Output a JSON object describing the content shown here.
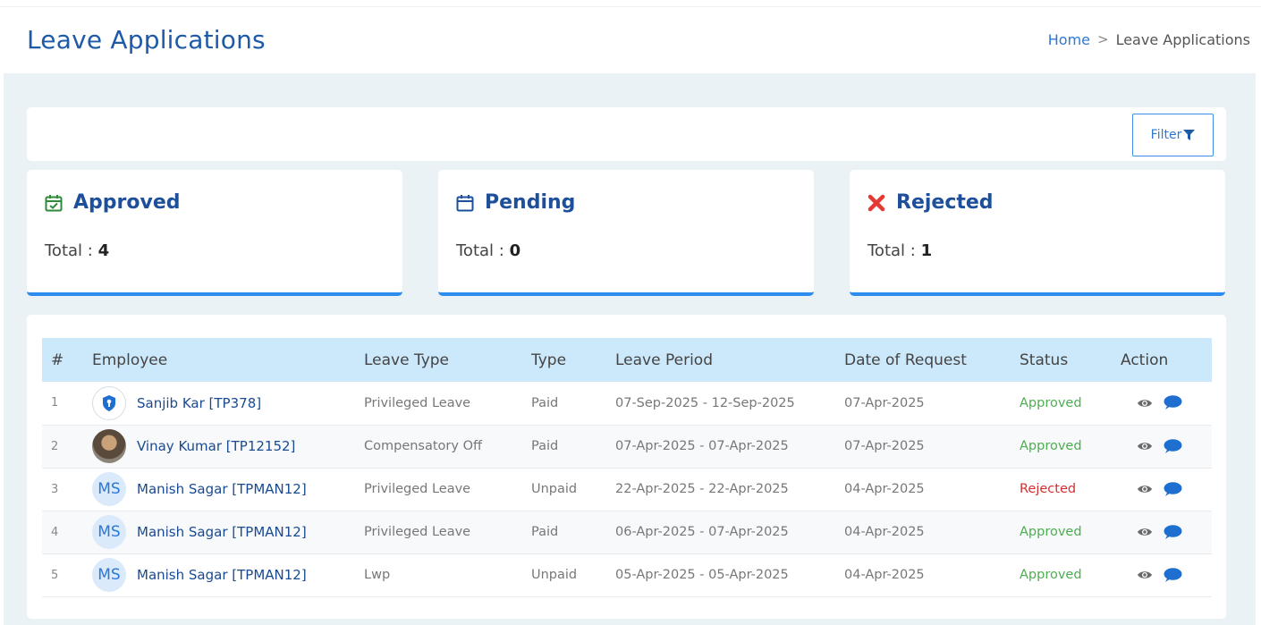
{
  "header": {
    "title": "Leave Applications",
    "breadcrumb": {
      "home": "Home",
      "separator": ">",
      "current": "Leave Applications"
    }
  },
  "filter": {
    "label": "Filter",
    "icon": "funnel-icon"
  },
  "summary": [
    {
      "title": "Approved",
      "icon": "calendar-check-icon",
      "total_label": "Total :",
      "total": "4",
      "color": "#2e8b3a"
    },
    {
      "title": "Pending",
      "icon": "calendar-icon",
      "total_label": "Total :",
      "total": "0",
      "color": "#1e4f9a"
    },
    {
      "title": "Rejected",
      "icon": "x-mark-icon",
      "total_label": "Total :",
      "total": "1",
      "color": "#e53935"
    }
  ],
  "table": {
    "columns": [
      "#",
      "Employee",
      "Leave Type",
      "Type",
      "Leave Period",
      "Date of Request",
      "Status",
      "Action"
    ],
    "rows": [
      {
        "idx": "1",
        "avatar": "logo",
        "avatar_text": "",
        "employee": "Sanjib Kar [TP378]",
        "leave_type": "Privileged Leave",
        "type": "Paid",
        "period": "07-Sep-2025 - 12-Sep-2025",
        "requested": "07-Apr-2025",
        "status": "Approved"
      },
      {
        "idx": "2",
        "avatar": "photo",
        "avatar_text": "",
        "employee": "Vinay Kumar [TP12152]",
        "leave_type": "Compensatory Off",
        "type": "Paid",
        "period": "07-Apr-2025 - 07-Apr-2025",
        "requested": "07-Apr-2025",
        "status": "Approved"
      },
      {
        "idx": "3",
        "avatar": "initials",
        "avatar_text": "MS",
        "employee": "Manish Sagar [TPMAN12]",
        "leave_type": "Privileged Leave",
        "type": "Unpaid",
        "period": "22-Apr-2025 - 22-Apr-2025",
        "requested": "04-Apr-2025",
        "status": "Rejected"
      },
      {
        "idx": "4",
        "avatar": "initials",
        "avatar_text": "MS",
        "employee": "Manish Sagar [TPMAN12]",
        "leave_type": "Privileged Leave",
        "type": "Paid",
        "period": "06-Apr-2025 - 07-Apr-2025",
        "requested": "04-Apr-2025",
        "status": "Approved"
      },
      {
        "idx": "5",
        "avatar": "initials",
        "avatar_text": "MS",
        "employee": "Manish Sagar [TPMAN12]",
        "leave_type": "Lwp",
        "type": "Unpaid",
        "period": "05-Apr-2025 - 05-Apr-2025",
        "requested": "04-Apr-2025",
        "status": "Approved"
      }
    ],
    "action_icons": [
      "eye-icon",
      "comment-icon"
    ]
  },
  "colors": {
    "accent": "#2d8cf0",
    "title": "#1e5aa8",
    "approved": "#4caf50",
    "rejected": "#d32f2f",
    "header_row": "#cce8fb"
  }
}
